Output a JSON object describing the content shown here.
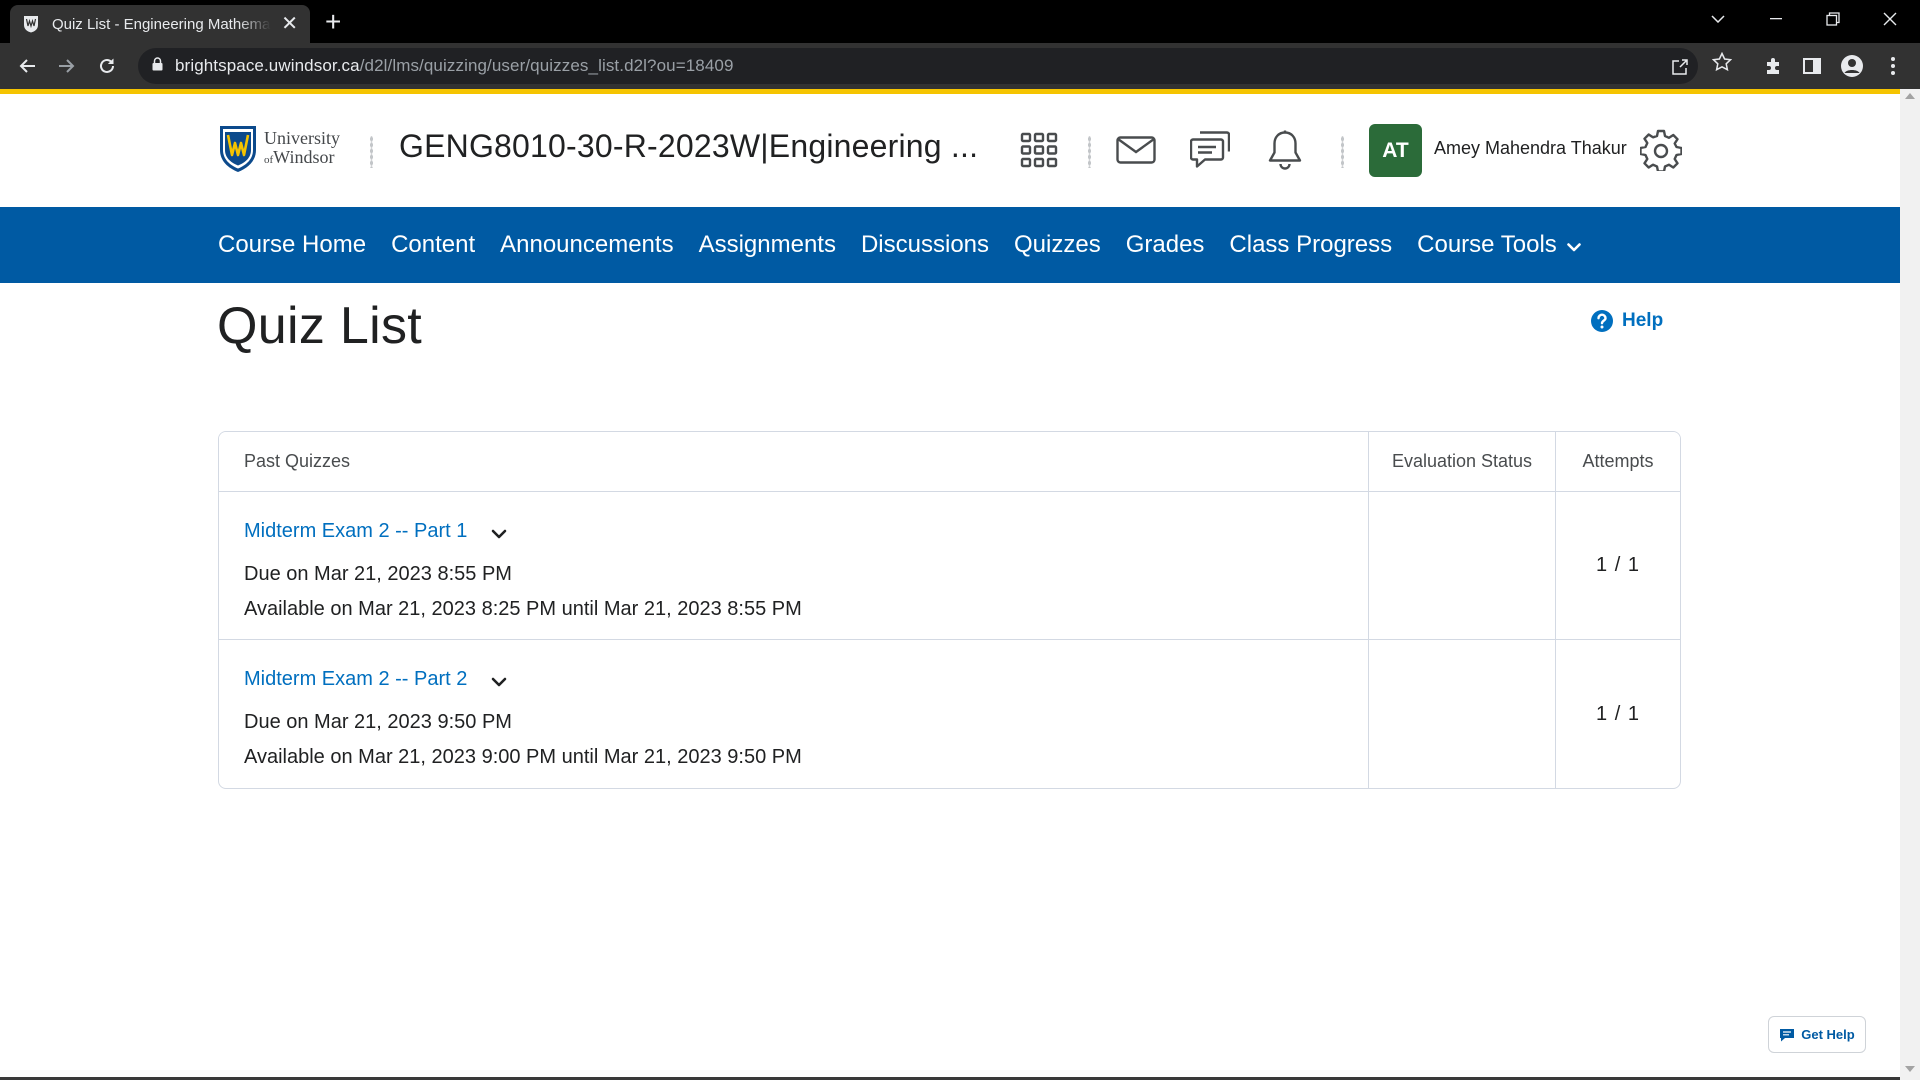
{
  "browser": {
    "tab_title": "Quiz List - Engineering Mathematics",
    "url_host": "brightspace.uwindsor.ca",
    "url_path": "/d2l/lms/quizzing/user/quizzes_list.d2l?ou=18409"
  },
  "header": {
    "logo_line1": "University",
    "logo_of": "of",
    "logo_line2": "Windsor",
    "course_title": "GENG8010-30-R-2023W|Engineering ...",
    "avatar_initials": "AT",
    "user_name": "Amey Mahendra Thakur",
    "icons": [
      "waffle-icon",
      "mail-icon",
      "chat-icon",
      "bell-icon",
      "gear-icon"
    ]
  },
  "nav": {
    "items": [
      "Course Home",
      "Content",
      "Announcements",
      "Assignments",
      "Discussions",
      "Quizzes",
      "Grades",
      "Class Progress",
      "Course Tools"
    ]
  },
  "main": {
    "page_title": "Quiz List",
    "help_label": "Help",
    "table": {
      "headers": [
        "Past Quizzes",
        "Evaluation Status",
        "Attempts"
      ],
      "rows": [
        {
          "name": "Midterm Exam 2 -- Part 1",
          "due": "Due on Mar 21, 2023 8:55 PM",
          "available": "Available on Mar 21, 2023 8:25 PM until Mar 21, 2023 8:55 PM",
          "evaluation_status": "",
          "attempts": "1 / 1"
        },
        {
          "name": "Midterm Exam 2 -- Part 2",
          "due": "Due on Mar 21, 2023 9:50 PM",
          "available": "Available on Mar 21, 2023 9:00 PM until Mar 21, 2023 9:50 PM",
          "evaluation_status": "",
          "attempts": "1 / 1"
        }
      ]
    },
    "get_help_label": "Get Help"
  },
  "colors": {
    "nav_bg": "#005aa3",
    "link": "#006fbf",
    "avatar_bg": "#2b6b39",
    "accent_line": "#f5c400"
  }
}
